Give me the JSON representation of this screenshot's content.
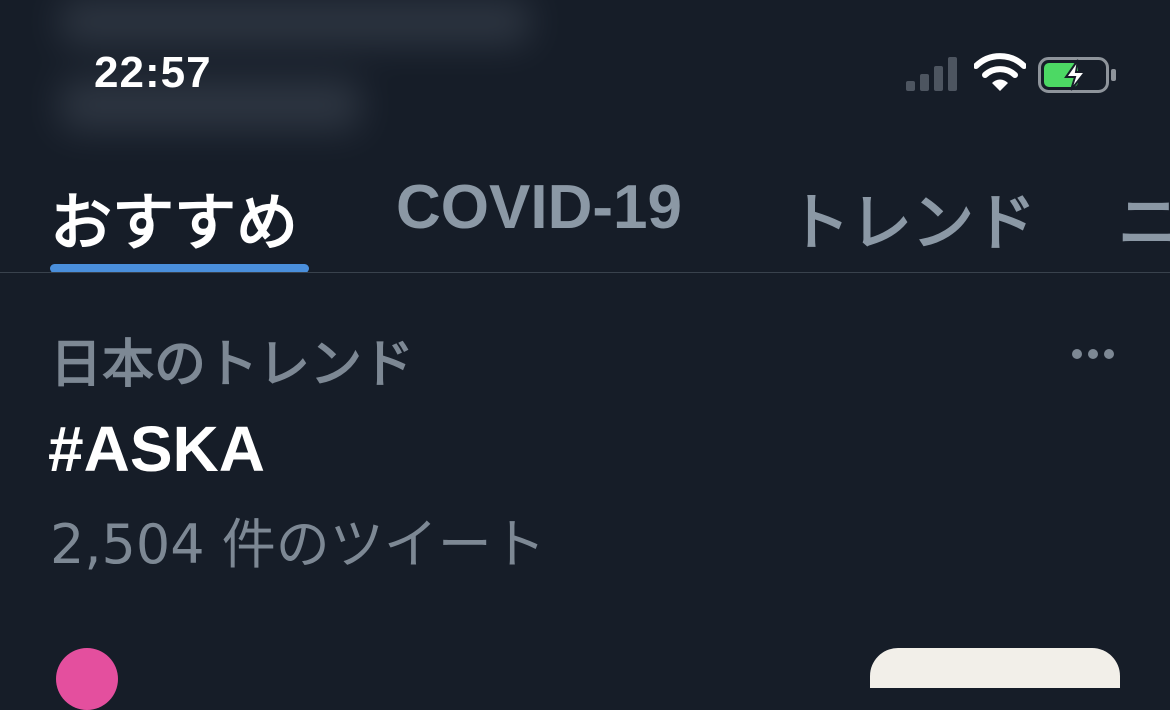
{
  "status_bar": {
    "time": "22:57",
    "icons": [
      "cellular-signal-icon",
      "wifi-icon",
      "battery-charging-icon"
    ],
    "battery_color": "#4cd964"
  },
  "tabs": [
    {
      "label": "おすすめ",
      "active": true
    },
    {
      "label": "COVID-19",
      "active": false
    },
    {
      "label": "トレンド",
      "active": false
    },
    {
      "label": "ニ",
      "active": false
    }
  ],
  "trend": {
    "category": "日本のトレンド",
    "name": "#ASKA",
    "tweet_count": "2,504 件のツイート",
    "more_icon": "more-horizontal-icon"
  },
  "colors": {
    "background": "#161d28",
    "accent": "#4a8fdc",
    "secondary_text": "#7d8894",
    "avatar": "#e44f9e"
  }
}
